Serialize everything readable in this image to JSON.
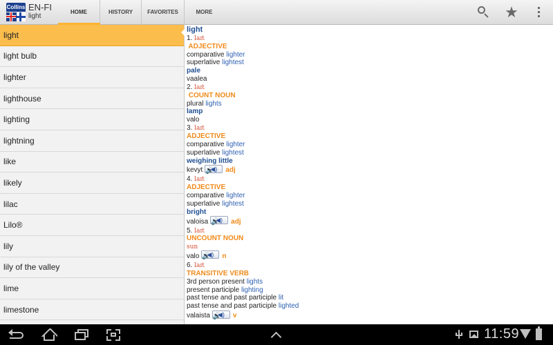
{
  "app": {
    "title": "EN-FI",
    "current_word": "light",
    "logo_text": "Collins"
  },
  "tabs": [
    {
      "label": "HOME",
      "selected": true
    },
    {
      "label": "HISTORY",
      "selected": false
    },
    {
      "label": "FAVORITES",
      "selected": false
    },
    {
      "label": "MORE",
      "selected": false
    }
  ],
  "action_icons": [
    "search-icon",
    "star-icon",
    "overflow-menu-icon"
  ],
  "word_list": {
    "selected_index": 0,
    "items": [
      "light",
      "light bulb",
      "lighter",
      "lighthouse",
      "lighting",
      "lightning",
      "like",
      "likely",
      "lilac",
      "Lilo®",
      "lily",
      "lily of the valley",
      "lime",
      "limestone"
    ]
  },
  "entry": {
    "headword": "light",
    "lines": [
      {
        "type": "sense",
        "num": "1.",
        "ipa": "laɪt"
      },
      {
        "type": "pos",
        "text": " ADJECTIVE"
      },
      {
        "type": "form",
        "label": "comparative",
        "value": "lighter"
      },
      {
        "type": "form",
        "label": "superlative",
        "value": "lightest"
      },
      {
        "type": "meaning",
        "text": "pale"
      },
      {
        "type": "trans",
        "text": "vaalea"
      },
      {
        "type": "sense",
        "num": "2.",
        "ipa": "laɪt"
      },
      {
        "type": "pos",
        "text": " COUNT NOUN"
      },
      {
        "type": "form",
        "label": "plural",
        "value": "lights"
      },
      {
        "type": "meaning",
        "text": "lamp"
      },
      {
        "type": "trans",
        "text": "valo"
      },
      {
        "type": "sense",
        "num": "3.",
        "ipa": "laɪt"
      },
      {
        "type": "pos",
        "text": "ADJECTIVE"
      },
      {
        "type": "form",
        "label": "comparative",
        "value": "lighter"
      },
      {
        "type": "form",
        "label": "superlative",
        "value": "lightest"
      },
      {
        "type": "meaning",
        "text": "weighing little"
      },
      {
        "type": "trans-audio",
        "text": "kevyt",
        "gram": "adj"
      },
      {
        "type": "sense",
        "num": "4.",
        "ipa": "laɪt"
      },
      {
        "type": "pos",
        "text": "ADJECTIVE"
      },
      {
        "type": "form",
        "label": "comparative",
        "value": "lighter"
      },
      {
        "type": "form",
        "label": "superlative",
        "value": "lightest"
      },
      {
        "type": "meaning",
        "text": "bright"
      },
      {
        "type": "trans-audio",
        "text": "valoisa",
        "gram": "adj"
      },
      {
        "type": "sense",
        "num": "5.",
        "ipa": "laɪt"
      },
      {
        "type": "pos",
        "text": "UNCOUNT NOUN"
      },
      {
        "type": "gloss",
        "text": "sun"
      },
      {
        "type": "trans-audio",
        "text": "valo",
        "gram": "n"
      },
      {
        "type": "sense",
        "num": "6.",
        "ipa": "laɪt"
      },
      {
        "type": "pos",
        "text": "TRANSITIVE VERB"
      },
      {
        "type": "form",
        "label": "3rd person present",
        "value": "lights"
      },
      {
        "type": "form",
        "label": "present participle",
        "value": "lighting"
      },
      {
        "type": "form",
        "label": "past tense and past participle",
        "value": "lit"
      },
      {
        "type": "form",
        "label": "past tense and past participle",
        "value": "lighted"
      },
      {
        "type": "trans-audio",
        "text": "valaista",
        "gram": "v"
      }
    ]
  },
  "system_bar": {
    "time": "11:59"
  },
  "colors": {
    "selected_row": "#fbbd4c",
    "tab_indicator": "#fbb430",
    "headword": "#1f4e91",
    "pos": "#f08a1a",
    "link": "#2d5fb2",
    "ipa": "#d24a2e"
  }
}
